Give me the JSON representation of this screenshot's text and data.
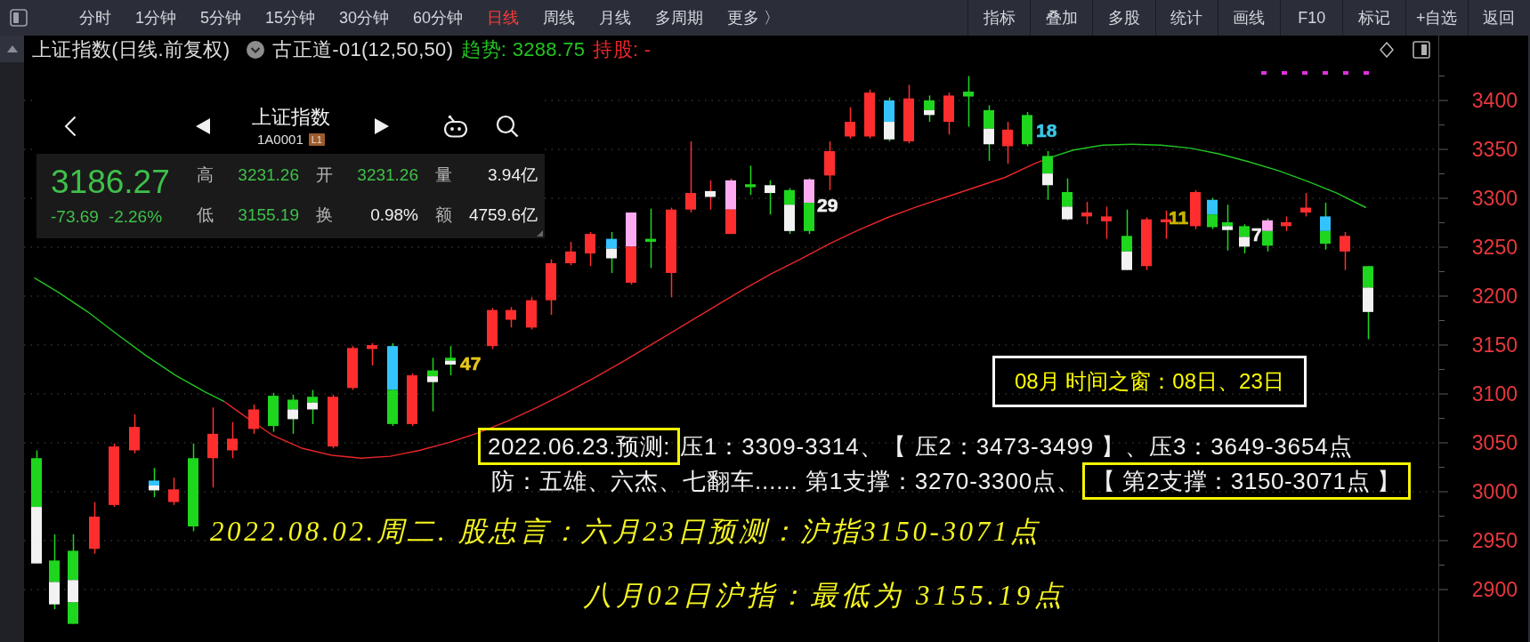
{
  "toolbar": {
    "period_tabs": [
      {
        "label": "分时",
        "selected": false
      },
      {
        "label": "1分钟",
        "selected": false
      },
      {
        "label": "5分钟",
        "selected": false
      },
      {
        "label": "15分钟",
        "selected": false
      },
      {
        "label": "30分钟",
        "selected": false
      },
      {
        "label": "60分钟",
        "selected": false
      },
      {
        "label": "日线",
        "selected": true
      },
      {
        "label": "周线",
        "selected": false
      },
      {
        "label": "月线",
        "selected": false
      },
      {
        "label": "多周期",
        "selected": false
      }
    ],
    "more_menu": "更多 〉",
    "tools": [
      "指标",
      "叠加",
      "多股",
      "统计",
      "画线",
      "F10",
      "标记",
      "+自选",
      "返回"
    ]
  },
  "chart_header": {
    "title": "上证指数(日线.前复权)",
    "indicator": "古正道-01(12,50,50)",
    "trend": "趋势: 3288.75",
    "holding": "持股: -"
  },
  "quote_panel": {
    "name": "上证指数",
    "code": "1A0001",
    "badge": "L1",
    "price": "3186.27",
    "change": "-73.69",
    "change_percent": "-2.26%",
    "stats": [
      {
        "label": "高",
        "value": "3231.26",
        "kind": "price"
      },
      {
        "label": "开",
        "value": "3231.26",
        "kind": "price"
      },
      {
        "label": "量",
        "value": "3.94亿",
        "kind": "total"
      },
      {
        "label": "低",
        "value": "3155.19",
        "kind": "price"
      },
      {
        "label": "换",
        "value": "0.98%",
        "kind": "total"
      },
      {
        "label": "额",
        "value": "4759.6亿",
        "kind": "total"
      }
    ]
  },
  "chart_markers": [
    {
      "text": "47",
      "color": "#e6c619"
    },
    {
      "text": "29",
      "color": "#f0f0f0"
    },
    {
      "text": "18",
      "color": "#3cc8e8"
    },
    {
      "text": "11",
      "color": "#c8b400"
    },
    {
      "text": "7",
      "color": "#f0f0f0"
    }
  ],
  "time_window": "08月 时间之窗：08日、23日",
  "forecast": {
    "date": "2022.06.23.预测:",
    "resistance": "压1：3309-3314、【 压2：3473-3499 】、压3：3649-3654点",
    "support": "防：五雄、六杰、七翻车...... 第1支撑：3270-3300点、",
    "key_support": "【 第2支撑：3150-3071点 】"
  },
  "commentary": [
    "2022.08.02.周二. 股忠言：六月23日预测：沪指3150-3071点",
    "八月02日沪指：最低为 3155.19点"
  ],
  "price_axis": [
    "3400",
    "3350",
    "3300",
    "3250",
    "3200",
    "3150",
    "3100",
    "3050",
    "3000",
    "2950",
    "2900"
  ]
}
